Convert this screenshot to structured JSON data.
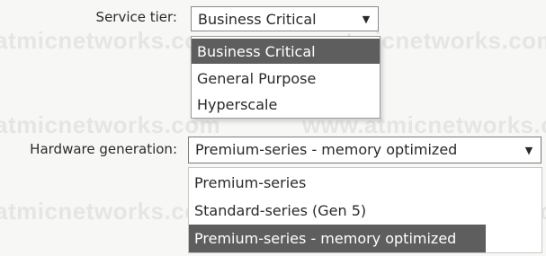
{
  "watermark": {
    "text_a": "atmicnetworks.com",
    "text_b": "www.atmicnetworks.com",
    "text_c": "atmicnetworks.com",
    "text_d": "www.atmicnetworks.com"
  },
  "service_tier": {
    "label": "Service tier:",
    "value": "Business Critical",
    "options": [
      "Business Critical",
      "General Purpose",
      "Hyperscale"
    ],
    "highlighted": "Business Critical"
  },
  "hardware_generation": {
    "label": "Hardware generation:",
    "value": "Premium-series - memory optimized",
    "options": [
      "Premium-series",
      "Standard-series (Gen 5)",
      "Premium-series - memory optimized"
    ],
    "highlighted": "Premium-series - memory optimized"
  },
  "colors": {
    "highlight_bg": "#5e5e5e",
    "highlight_text": "#ffffff"
  },
  "icons": {
    "dropdown_arrow": "chevron-down-icon"
  }
}
